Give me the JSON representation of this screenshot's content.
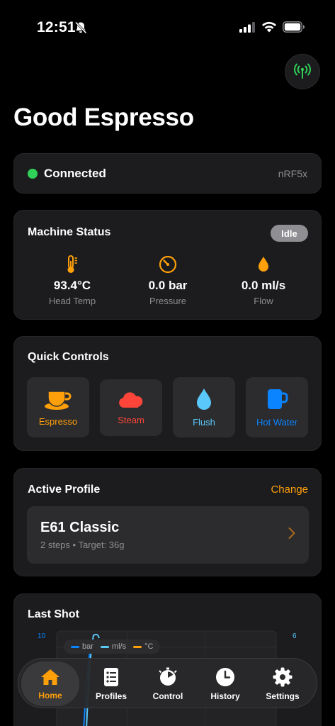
{
  "status_bar": {
    "time": "12:51"
  },
  "header": {
    "title": "Good Espresso"
  },
  "connection": {
    "label": "Connected",
    "device": "nRF5x",
    "color": "#30d158"
  },
  "machine_status": {
    "title": "Machine Status",
    "state": "Idle",
    "metrics": [
      {
        "value": "93.4°C",
        "label": "Head Temp",
        "icon": "thermometer-icon"
      },
      {
        "value": "0.0 bar",
        "label": "Pressure",
        "icon": "gauge-icon"
      },
      {
        "value": "0.0 ml/s",
        "label": "Flow",
        "icon": "drop-icon"
      }
    ]
  },
  "quick_controls": {
    "title": "Quick Controls",
    "buttons": [
      {
        "label": "Espresso",
        "color": "#ff9f0a",
        "icon": "coffee-cup-icon"
      },
      {
        "label": "Steam",
        "color": "#ff453a",
        "icon": "cloud-icon"
      },
      {
        "label": "Flush",
        "color": "#5ac8fa",
        "icon": "water-drop-icon"
      },
      {
        "label": "Hot Water",
        "color": "#0a84ff",
        "icon": "mug-icon"
      }
    ]
  },
  "active_profile": {
    "title": "Active Profile",
    "change": "Change",
    "name": "E61 Classic",
    "meta": "2 steps • Target: 36g"
  },
  "last_shot": {
    "title": "Last Shot",
    "left_axis_top": "10",
    "right_axis_top": "6",
    "legend": [
      {
        "name": "bar",
        "color": "#0a84ff"
      },
      {
        "name": "ml/s",
        "color": "#5ac8fa"
      },
      {
        "name": "°C",
        "color": "#ff9f0a"
      }
    ]
  },
  "tabs": [
    {
      "label": "Home",
      "icon": "house-icon",
      "active": true
    },
    {
      "label": "Profiles",
      "icon": "profiles-list-icon",
      "active": false
    },
    {
      "label": "Control",
      "icon": "timer-dial-icon",
      "active": false
    },
    {
      "label": "History",
      "icon": "clock-icon",
      "active": false
    },
    {
      "label": "Settings",
      "icon": "gear-icon",
      "active": false
    }
  ],
  "colors": {
    "accent": "#ff9f0a",
    "card": "#1c1c1e",
    "secondary_text": "#8e8e93"
  }
}
